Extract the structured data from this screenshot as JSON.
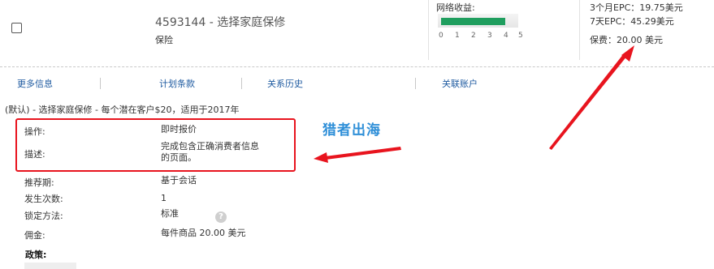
{
  "offer": {
    "title": "4593144 - 选择家庭保修",
    "category": "保险"
  },
  "earnings": {
    "label": "网络收益:",
    "level": 0.8,
    "scale": [
      "0",
      "1",
      "2",
      "3",
      "4",
      "5"
    ]
  },
  "stats": {
    "epc_3month": "3个月EPC：19.75美元",
    "epc_7day": "7天EPC：45.29美元",
    "payout": "保费：20.00 美元"
  },
  "tabs": {
    "more_info": "更多信息",
    "plan_terms": "计划条款",
    "relation_history": "关系历史",
    "linked_accounts": "关联账户"
  },
  "details": {
    "description": "(默认) - 选择家庭保修 - 每个潜在客户$20，适用于2017年",
    "action_label": "操作:",
    "action_value": "即时报价",
    "desc_label": "描述:",
    "desc_value_line1": "完成包含正确消费者信息",
    "desc_value_line2": "的页面。",
    "referral_label": "推荐期:",
    "referral_value": "基于会话",
    "occurrence_label": "发生次数:",
    "occurrence_value": "1",
    "lock_label": "锁定方法:",
    "lock_value": "标准",
    "help_glyph": "?",
    "commission_label": "佣金:",
    "commission_value": "每件商品 20.00 美元",
    "policy_label": "政策:"
  },
  "watermark": "猎者出海",
  "colors": {
    "link": "#1e5aa0",
    "meter_fill": "#1f9e5e",
    "highlight": "#e8141e",
    "watermark": "#2f8fd8"
  },
  "icons": {
    "checkbox": "checkbox-icon",
    "help": "question-circle-icon",
    "arrows": "red-arrow-annotation"
  }
}
